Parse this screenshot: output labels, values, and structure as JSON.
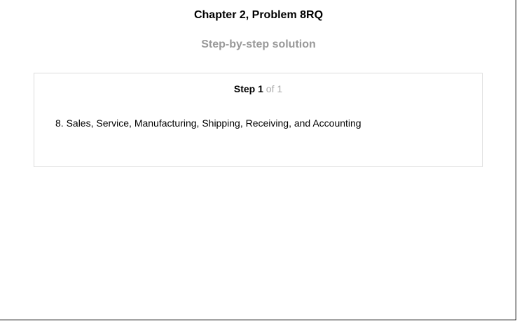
{
  "header": {
    "title": "Chapter 2, Problem 8RQ",
    "subtitle": "Step-by-step solution"
  },
  "step": {
    "label": "Step",
    "number": "1",
    "of_text": "of 1",
    "content": "8. Sales, Service, Manufacturing, Shipping, Receiving, and Accounting"
  }
}
